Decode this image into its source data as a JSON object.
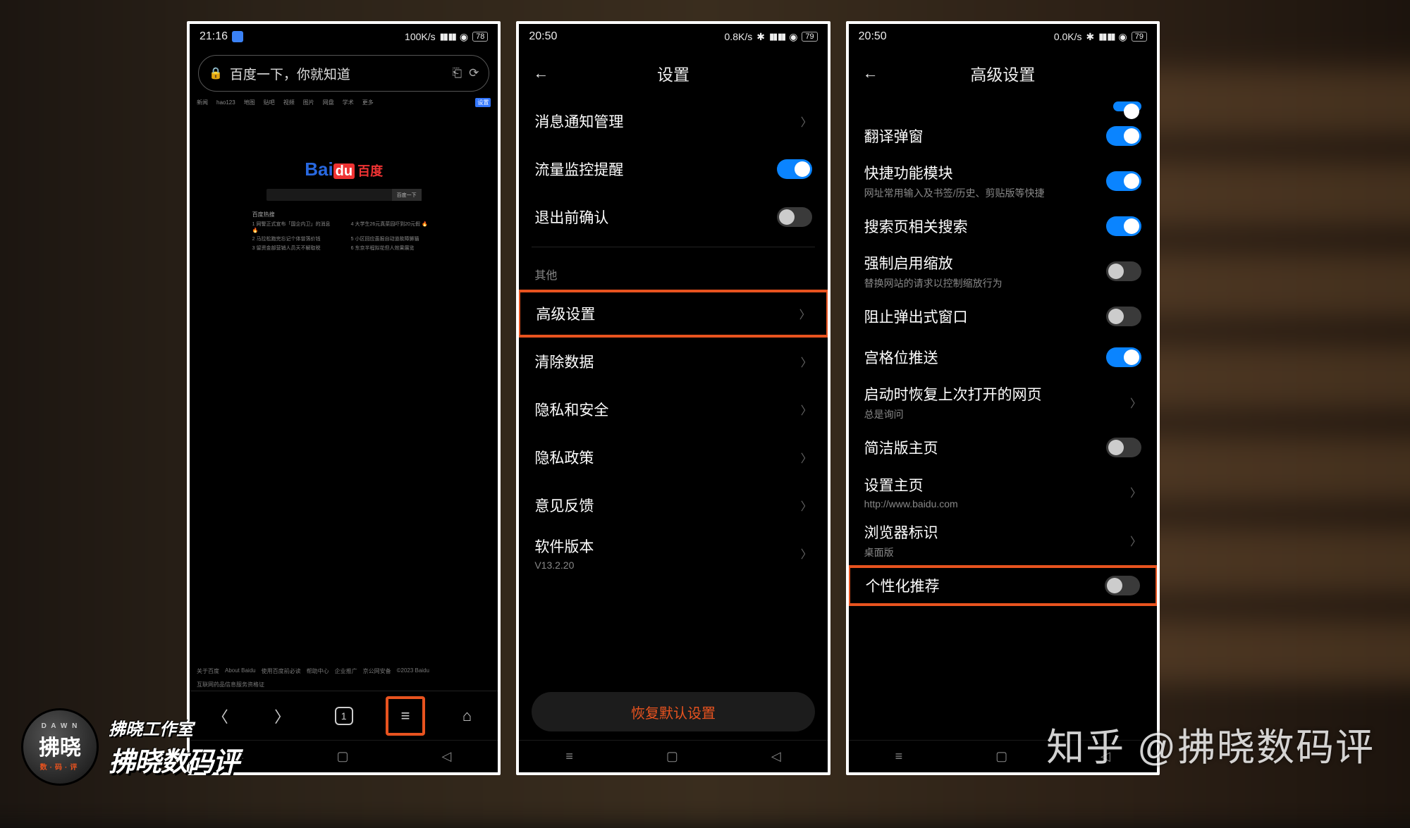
{
  "accent": "#0a84ff",
  "highlight": "#e8531f",
  "screen1": {
    "status": {
      "time": "21:16",
      "speed": "100K/s",
      "battery": "78"
    },
    "url_text": "百度一下，你就知道",
    "top_tabs": [
      "新闻",
      "hao123",
      "地图",
      "贴吧",
      "视频",
      "图片",
      "网盘",
      "学术",
      "更多",
      "设置"
    ],
    "logo_parts": [
      "Bai",
      "du",
      "百度"
    ],
    "search_btn": "百度一下",
    "hot_header": "百度热搜",
    "hot": [
      "1 网警正式宣布「国企内卫」的消息 🔥",
      "4 大学生26元真菜园吓到20元假 🔥",
      "2 马拉松跑完忘记个体曾落价钱",
      "5 小区回应虽报自动道故障狮猫",
      "3 留资金部营销人员天不解取税",
      "6 东京半程拟花但人效果展览"
    ],
    "footer1": [
      "关于百度",
      "About Baidu",
      "使用百度前必读",
      "帮助中心",
      "企业推广",
      "京公网安备",
      "©2023 Baidu",
      "互联网药品信息服务资格证"
    ],
    "bottom": {
      "tab_count": "1"
    }
  },
  "screen2": {
    "status": {
      "time": "20:50",
      "speed": "0.8K/s",
      "battery": "79"
    },
    "title": "设置",
    "rows_a": [
      {
        "label": "消息通知管理",
        "type": "nav"
      },
      {
        "label": "流量监控提醒",
        "type": "toggle",
        "on": true
      },
      {
        "label": "退出前确认",
        "type": "toggle",
        "on": false
      }
    ],
    "section": "其他",
    "rows_b": [
      {
        "label": "高级设置",
        "type": "nav",
        "highlight": true
      },
      {
        "label": "清除数据",
        "type": "nav"
      },
      {
        "label": "隐私和安全",
        "type": "nav"
      },
      {
        "label": "隐私政策",
        "type": "nav"
      },
      {
        "label": "意见反馈",
        "type": "nav"
      },
      {
        "label": "软件版本",
        "sub": "V13.2.20",
        "type": "nav"
      }
    ],
    "reset": "恢复默认设置"
  },
  "screen3": {
    "status": {
      "time": "20:50",
      "speed": "0.0K/s",
      "battery": "79"
    },
    "title": "高级设置",
    "rows": [
      {
        "label": "翻译弹窗",
        "type": "toggle",
        "on": true
      },
      {
        "label": "快捷功能模块",
        "sub": "网址常用输入及书签/历史、剪贴版等快捷",
        "type": "toggle",
        "on": true
      },
      {
        "label": "搜索页相关搜索",
        "type": "toggle",
        "on": true
      },
      {
        "label": "强制启用缩放",
        "sub": "替换网站的请求以控制缩放行为",
        "type": "toggle",
        "on": false
      },
      {
        "label": "阻止弹出式窗口",
        "type": "toggle",
        "on": false
      },
      {
        "label": "宫格位推送",
        "type": "toggle",
        "on": true
      },
      {
        "label": "启动时恢复上次打开的网页",
        "sub": "总是询问",
        "type": "nav"
      },
      {
        "label": "简洁版主页",
        "type": "toggle",
        "on": false
      },
      {
        "label": "设置主页",
        "sub": "http://www.baidu.com",
        "type": "nav"
      },
      {
        "label": "浏览器标识",
        "sub": "桌面版",
        "type": "nav"
      },
      {
        "label": "个性化推荐",
        "type": "toggle",
        "on": false,
        "highlight": true
      }
    ]
  },
  "badge": {
    "arc": "D A W N",
    "circle_main": "拂晓",
    "dots": "数·码·评",
    "line1": "拂晓工作室",
    "line2": "拂晓数码评"
  },
  "watermark": "知乎 @拂晓数码评"
}
